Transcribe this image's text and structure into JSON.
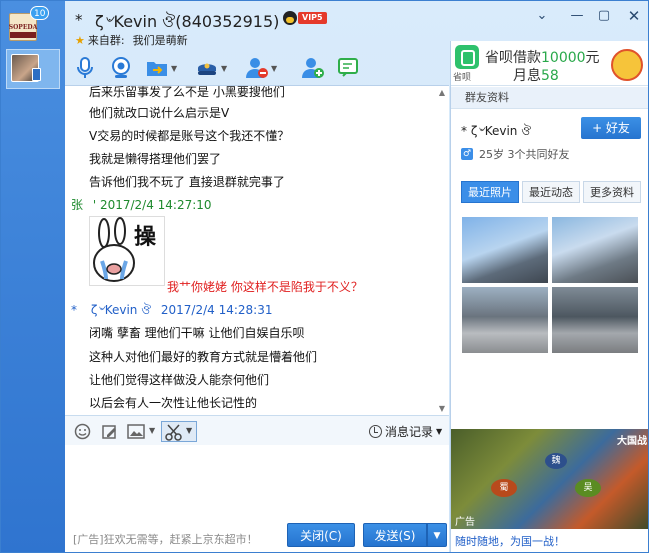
{
  "left_bar": {
    "badge": "10",
    "logo_text": "SOPEDA"
  },
  "header": {
    "star": "*",
    "name": "ζ৺Kevin ঔ(840352915)",
    "vip": "VIP5",
    "from_label": "来自群:",
    "group_name": "我们是萌新"
  },
  "chat": {
    "messages_a": [
      "后来乐留事发了么不是 小黑要搜他们",
      "他们就改口说什么启示是V",
      "V交易的时候都是账号这个我还不懂？",
      "我就是懒得搭理他们罢了",
      "告诉他们我不玩了 直接退群就完事了"
    ],
    "header_1": {
      "name": "张",
      "time": "' 2017/2/4 14:27:10"
    },
    "sticker_text": "操",
    "red_message": "我艹你姥姥 你这样不是陷我于不义？",
    "header_2": {
      "star": "*",
      "name": "ζ৺Kevin ঔ",
      "time": "2017/2/4 14:28:31"
    },
    "messages_b": [
      "闭嘴 孽畜 理他们干嘛 让他们自娱自乐呗",
      "这种人对他们最好的教育方式就是懵着他们",
      "让他们觉得这样做没人能奈何他们",
      "以后会有人一次性让他长记性的"
    ]
  },
  "input_bar": {
    "history_label": "消息记录"
  },
  "bottom": {
    "ad_text": "[广告]狂欢无需等，赶紧上京东超市！",
    "close_label": "关闭(C)",
    "send_label": "发送(S)"
  },
  "right_panel": {
    "banner_app": "省呗",
    "banner_line1_prefix": "省呗借款",
    "banner_line1_amount": "10000",
    "banner_line1_suffix": "元",
    "banner_line2_prefix": "月息",
    "banner_line2_rate": "58",
    "section_title": "群友资料",
    "friend_name": "* ζ৺Kevin ঔ",
    "add_friend": "+ 好友",
    "info": "25岁 3个共同好友",
    "sex_icon": "♂",
    "tabs": [
      "最近照片",
      "最近动态",
      "更多资料"
    ],
    "game_title": "大国战",
    "game_regions": [
      "魏",
      "蜀",
      "吴"
    ],
    "game_ad_label": "广告",
    "game_link": "随时随地，为国一战！"
  },
  "colors": {
    "accent": "#2674cf",
    "link": "#2260c8",
    "green_name": "#1f8a2e",
    "red_text": "#e02020"
  }
}
